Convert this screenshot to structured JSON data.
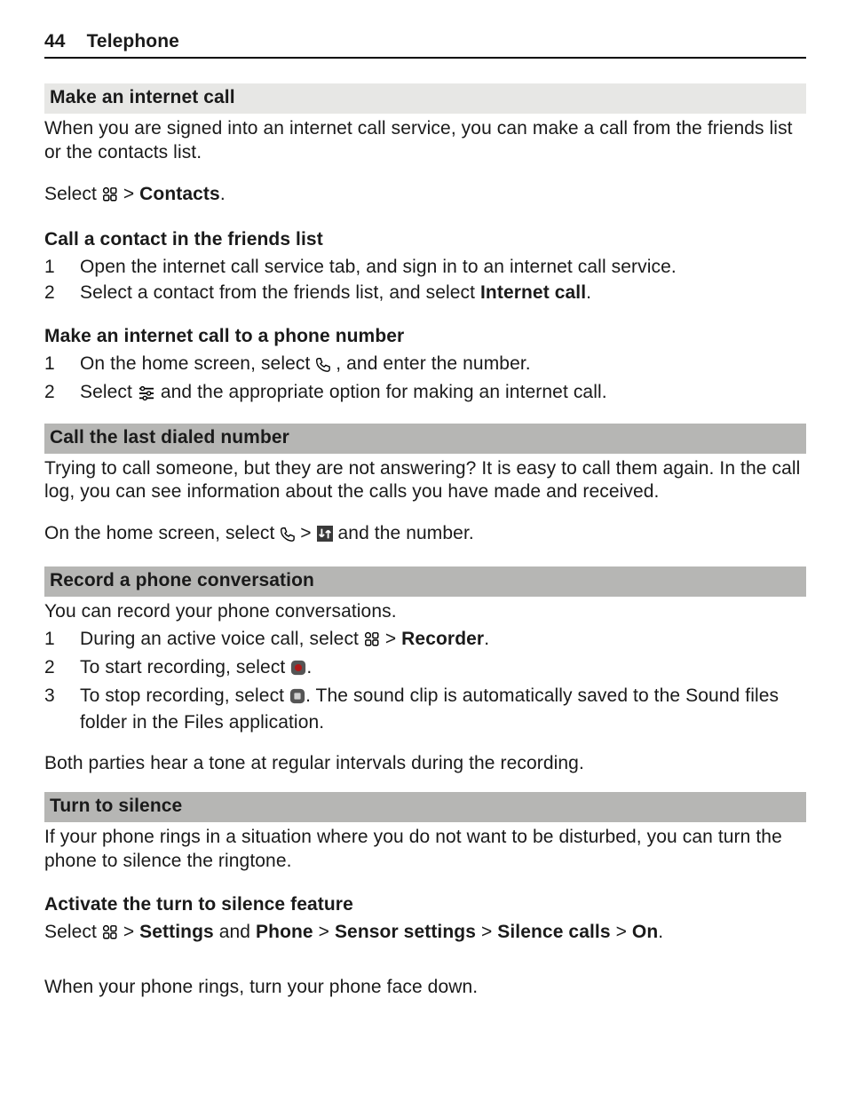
{
  "header": {
    "page": "44",
    "chapter": "Telephone"
  },
  "s1_title": "Make an internet call",
  "s1_p1": "When you are signed into an internet call service, you can make a call from the friends list or the contacts list.",
  "s1_select_pre": "Select ",
  "s1_select_gt": " > ",
  "s1_select_contacts": "Contacts",
  "s1_select_dot": ".",
  "s1a_head": "Call a contact in the friends list",
  "s1a_1": "Open the internet call service tab, and sign in to an internet call service.",
  "s1a_2a": "Select a contact from the friends list, and select ",
  "s1a_2b": "Internet call",
  "s1a_2c": ".",
  "s1b_head": "Make an internet call to a phone number",
  "s1b_1a": "On the home screen, select ",
  "s1b_1b": " , and enter the number.",
  "s1b_2a": "Select ",
  "s1b_2b": " and the appropriate option for making an internet call.",
  "s2_title": "Call the last dialed number",
  "s2_p1": "Trying to call someone, but they are not answering? It is easy to call them again. In the call log, you can see information about the calls you have made and received.",
  "s2_p2a": "On the home screen, select ",
  "s2_p2gt": " > ",
  "s2_p2b": " and the number.",
  "s3_title": "Record a phone conversation",
  "s3_p1": "You can record your phone conversations.",
  "s3_1a": "During an active voice call, select ",
  "s3_1gt": " > ",
  "s3_1b": "Recorder",
  "s3_1c": ".",
  "s3_2a": "To start recording, select ",
  "s3_2b": ".",
  "s3_3a": "To stop recording, select ",
  "s3_3b": ". The sound clip is automatically saved to the Sound files folder in the Files application.",
  "s3_p2": "Both parties hear a tone at regular intervals during the recording.",
  "s4_title": "Turn to silence",
  "s4_p1": "If your phone rings in a situation where you do not want to be disturbed, you can turn the phone to silence the ringtone.",
  "s4a_head": "Activate the turn to silence feature",
  "s4a_pre": "Select ",
  "s4a_gt": " > ",
  "s4a_settings": "Settings",
  "s4a_and": " and ",
  "s4a_phone": "Phone",
  "s4a_sensor": "Sensor settings",
  "s4a_silence": "Silence calls",
  "s4a_on": "On",
  "s4a_dot": ".",
  "s4_p2": "When your phone rings, turn your phone face down."
}
